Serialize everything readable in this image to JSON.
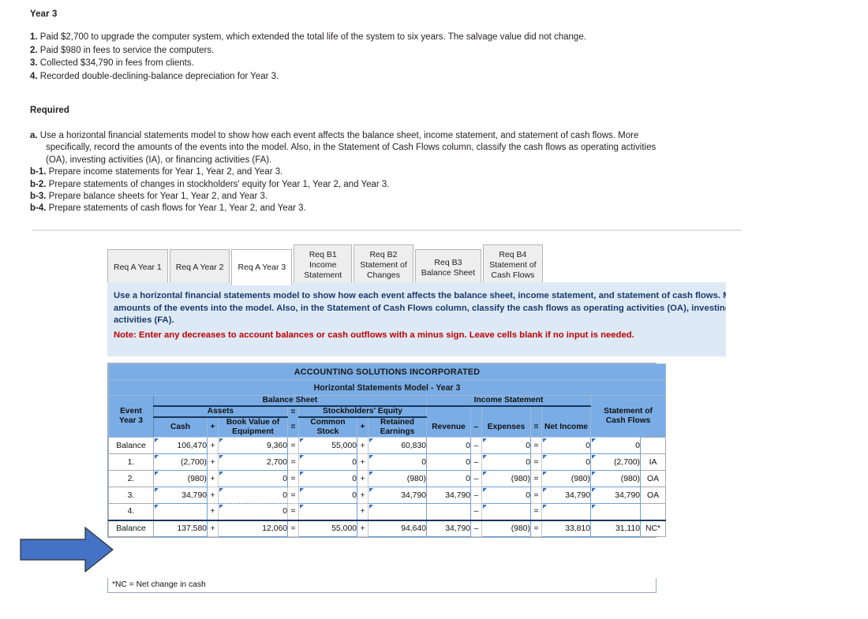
{
  "problem": {
    "year_title": "Year 3",
    "events": [
      {
        "num": "1.",
        "text": "Paid $2,700 to upgrade the computer system, which extended the total life of the system to six years. The salvage value did not change."
      },
      {
        "num": "2.",
        "text": "Paid $980 in fees to service the computers."
      },
      {
        "num": "3.",
        "text": "Collected $34,790 in fees from clients."
      },
      {
        "num": "4.",
        "text": "Recorded double-declining-balance depreciation for Year 3."
      }
    ],
    "required_heading": "Required",
    "requirements": [
      {
        "num": "a.",
        "text": "Use a horizontal financial statements model to show how each event affects the balance sheet, income statement, and statement of cash flows. More specifically, record the amounts of the events into the model. Also, in the Statement of Cash Flows column, classify the cash flows as operating activities (OA), investing activities (IA), or financing activities (FA)."
      },
      {
        "num": "b-1.",
        "text": "Prepare income statements for Year 1, Year 2, and Year 3."
      },
      {
        "num": "b-2.",
        "text": "Prepare statements of changes in stockholders' equity for Year 1, Year 2, and Year 3."
      },
      {
        "num": "b-3.",
        "text": "Prepare balance sheets for Year 1, Year 2, and Year 3."
      },
      {
        "num": "b-4.",
        "text": "Prepare statements of cash flows for Year 1, Year 2, and Year 3."
      }
    ]
  },
  "tabs": [
    {
      "label": "Req A Year 1",
      "active": false
    },
    {
      "label": "Req A Year 2",
      "active": false
    },
    {
      "label": "Req A Year 3",
      "active": true
    },
    {
      "label": "Req B1\nIncome\nStatement",
      "active": false
    },
    {
      "label": "Req B2\nStatement of\nChanges",
      "active": false
    },
    {
      "label": "Req B3\nBalance Sheet",
      "active": false
    },
    {
      "label": "Req B4\nStatement of\nCash Flows",
      "active": false
    }
  ],
  "instructions": {
    "line1": "Use a horizontal financial statements model to show how each event affects the balance sheet, income statement, and statement of cash flows. More",
    "line2": "amounts of the events into the model. Also, in the Statement of Cash Flows column, classify the cash flows as operating activities (OA), investing ac",
    "line3": "activities (FA).",
    "note": "Note: Enter any decreases to account balances or cash outflows with a minus sign. Leave cells blank if no input is needed."
  },
  "worksheet": {
    "company": "ACCOUNTING SOLUTIONS INCORPORATED",
    "subtitle": "Horizontal Statements Model - Year 3",
    "group_balance_sheet": "Balance Sheet",
    "group_income_statement": "Income Statement",
    "group_assets": "Assets",
    "group_equity": "Stockholders' Equity",
    "event_header": "Event\nYear 3",
    "col_cash": "Cash",
    "col_book_value": "Book Value of\nEquipment",
    "col_common_stock": "Common\nStock",
    "col_retained_earnings": "Retained\nEarnings",
    "col_revenue": "Revenue",
    "col_expenses": "Expenses",
    "col_net_income": "Net Income",
    "col_cash_flows": "Statement of\nCash Flows",
    "op_plus": "+",
    "op_equals": "=",
    "op_minus": "–",
    "rows": [
      {
        "label": "Balance",
        "cash": "106,470",
        "equipment": "9,360",
        "common_stock": "55,000",
        "retained_earnings": "60,830",
        "revenue": "0",
        "expenses": "0",
        "net_income": "0",
        "cash_flow": "0",
        "cf_class": ""
      },
      {
        "label": "1.",
        "cash": "(2,700)",
        "equipment": "2,700",
        "common_stock": "0",
        "retained_earnings": "0",
        "revenue": "0",
        "expenses": "0",
        "net_income": "0",
        "cash_flow": "(2,700)",
        "cf_class": "IA"
      },
      {
        "label": "2.",
        "cash": "(980)",
        "equipment": "0",
        "common_stock": "0",
        "retained_earnings": "(980)",
        "revenue": "0",
        "expenses": "(980)",
        "net_income": "(980)",
        "cash_flow": "(980)",
        "cf_class": "OA"
      },
      {
        "label": "3.",
        "cash": "34,790",
        "equipment": "0",
        "common_stock": "0",
        "retained_earnings": "34,790",
        "revenue": "34,790",
        "expenses": "0",
        "net_income": "34,790",
        "cash_flow": "34,790",
        "cf_class": "OA"
      },
      {
        "label": "4.",
        "cash": "",
        "equipment": "0",
        "common_stock": "",
        "retained_earnings": "",
        "revenue": "",
        "expenses": "",
        "net_income": "",
        "cash_flow": "",
        "cf_class": ""
      }
    ],
    "total_row": {
      "label": "Balance",
      "cash": "137,580",
      "equipment": "12,060",
      "common_stock": "55,000",
      "retained_earnings": "94,640",
      "revenue": "34,790",
      "expenses": "(980)",
      "net_income": "33,810",
      "cash_flow": "31,110",
      "cf_class": "NC*"
    },
    "footnote": "*NC = Net change in cash"
  },
  "annotation": {
    "arrow_icon": "right-arrow-icon",
    "color": "#4472c4"
  },
  "colors": {
    "header_blue": "#7aade5",
    "panel_blue": "#ddeaf6",
    "note_red": "#c00000",
    "instr_text": "#1b3a6b"
  }
}
